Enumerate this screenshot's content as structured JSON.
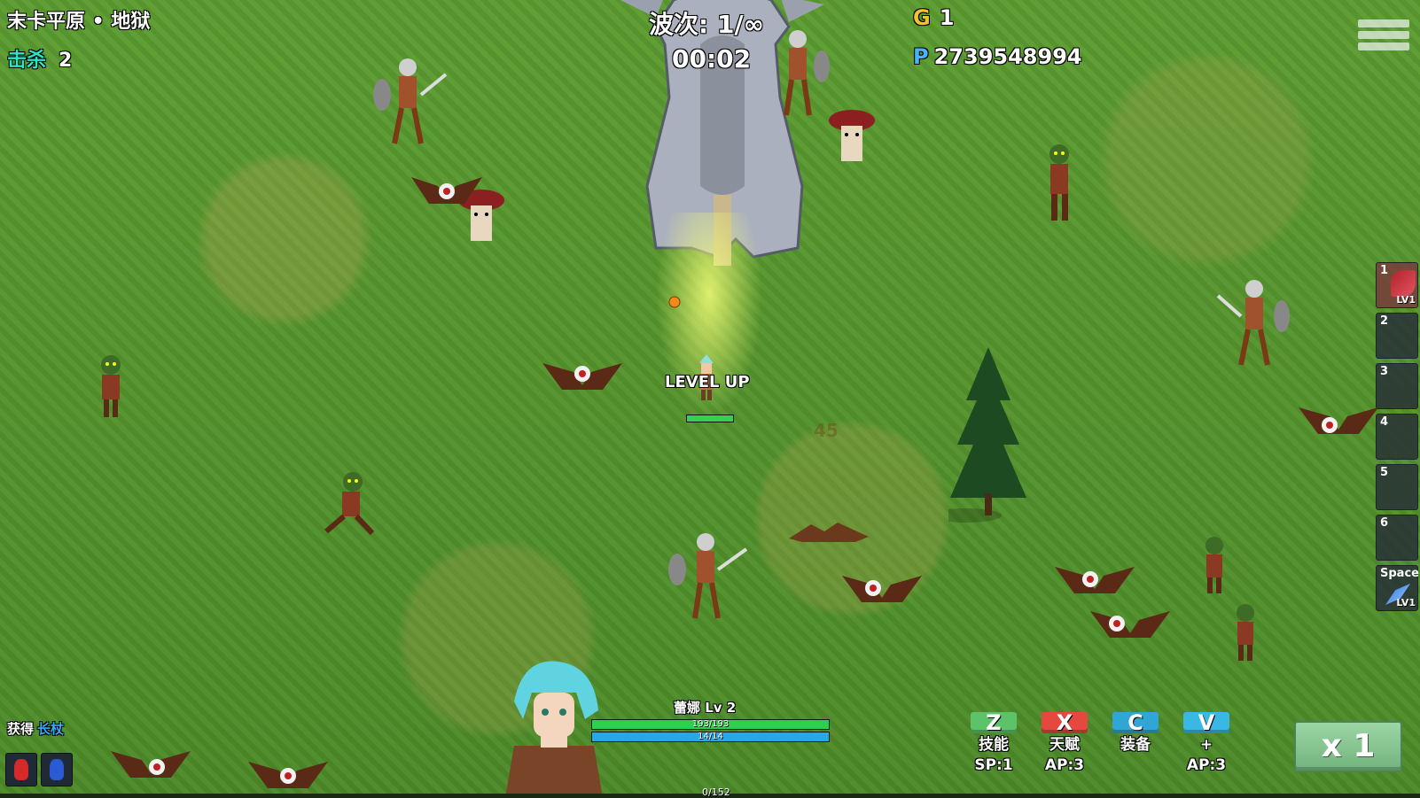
{
  "hud": {
    "map_name": "末卡平原 • 地狱",
    "kills_label": "击杀",
    "kills_value": "2",
    "wave": "波次: 1/∞",
    "timer": "00:02",
    "gold_icon": "G",
    "gold_value": "1",
    "points_icon": "P",
    "points_value": "2739548994"
  },
  "skill_slots": [
    {
      "num": "1",
      "level": "LV1",
      "icon": "crimson-slash-icon"
    },
    {
      "num": "2"
    },
    {
      "num": "3"
    },
    {
      "num": "4"
    },
    {
      "num": "5"
    },
    {
      "num": "6"
    },
    {
      "num": "Space",
      "level": "LV1",
      "icon": "dash-icon"
    }
  ],
  "player": {
    "level_up_text": "LEVEL UP",
    "damage_number": "45",
    "hp_fill": 1.0
  },
  "hero": {
    "name_level": "蕾娜  Lv 2",
    "hp_text": "193/193",
    "mp_text": "14/14",
    "hp_fraction": 1.0,
    "mp_fraction": 1.0,
    "exp_text": "0/152"
  },
  "actions": [
    {
      "key": "Z",
      "line1": "技能",
      "line2": "SP:1",
      "color": "#5cc36a"
    },
    {
      "key": "X",
      "line1": "天赋",
      "line2": "AP:3",
      "color": "#e4483e"
    },
    {
      "key": "C",
      "line1": "装备",
      "line2": "",
      "color": "#2fa6d6"
    },
    {
      "key": "V",
      "line1": "+",
      "line2": "AP:3",
      "color": "#39b8e3"
    }
  ],
  "speed": {
    "label": "x 1"
  },
  "loot": {
    "prefix": "获得",
    "item": "长杖"
  },
  "colors": {
    "kills_label": "#2fe3c7",
    "gold": "#f2c12e",
    "points": "#4ab2ff",
    "hp": "#2bd14e",
    "mp": "#26a7e8"
  }
}
